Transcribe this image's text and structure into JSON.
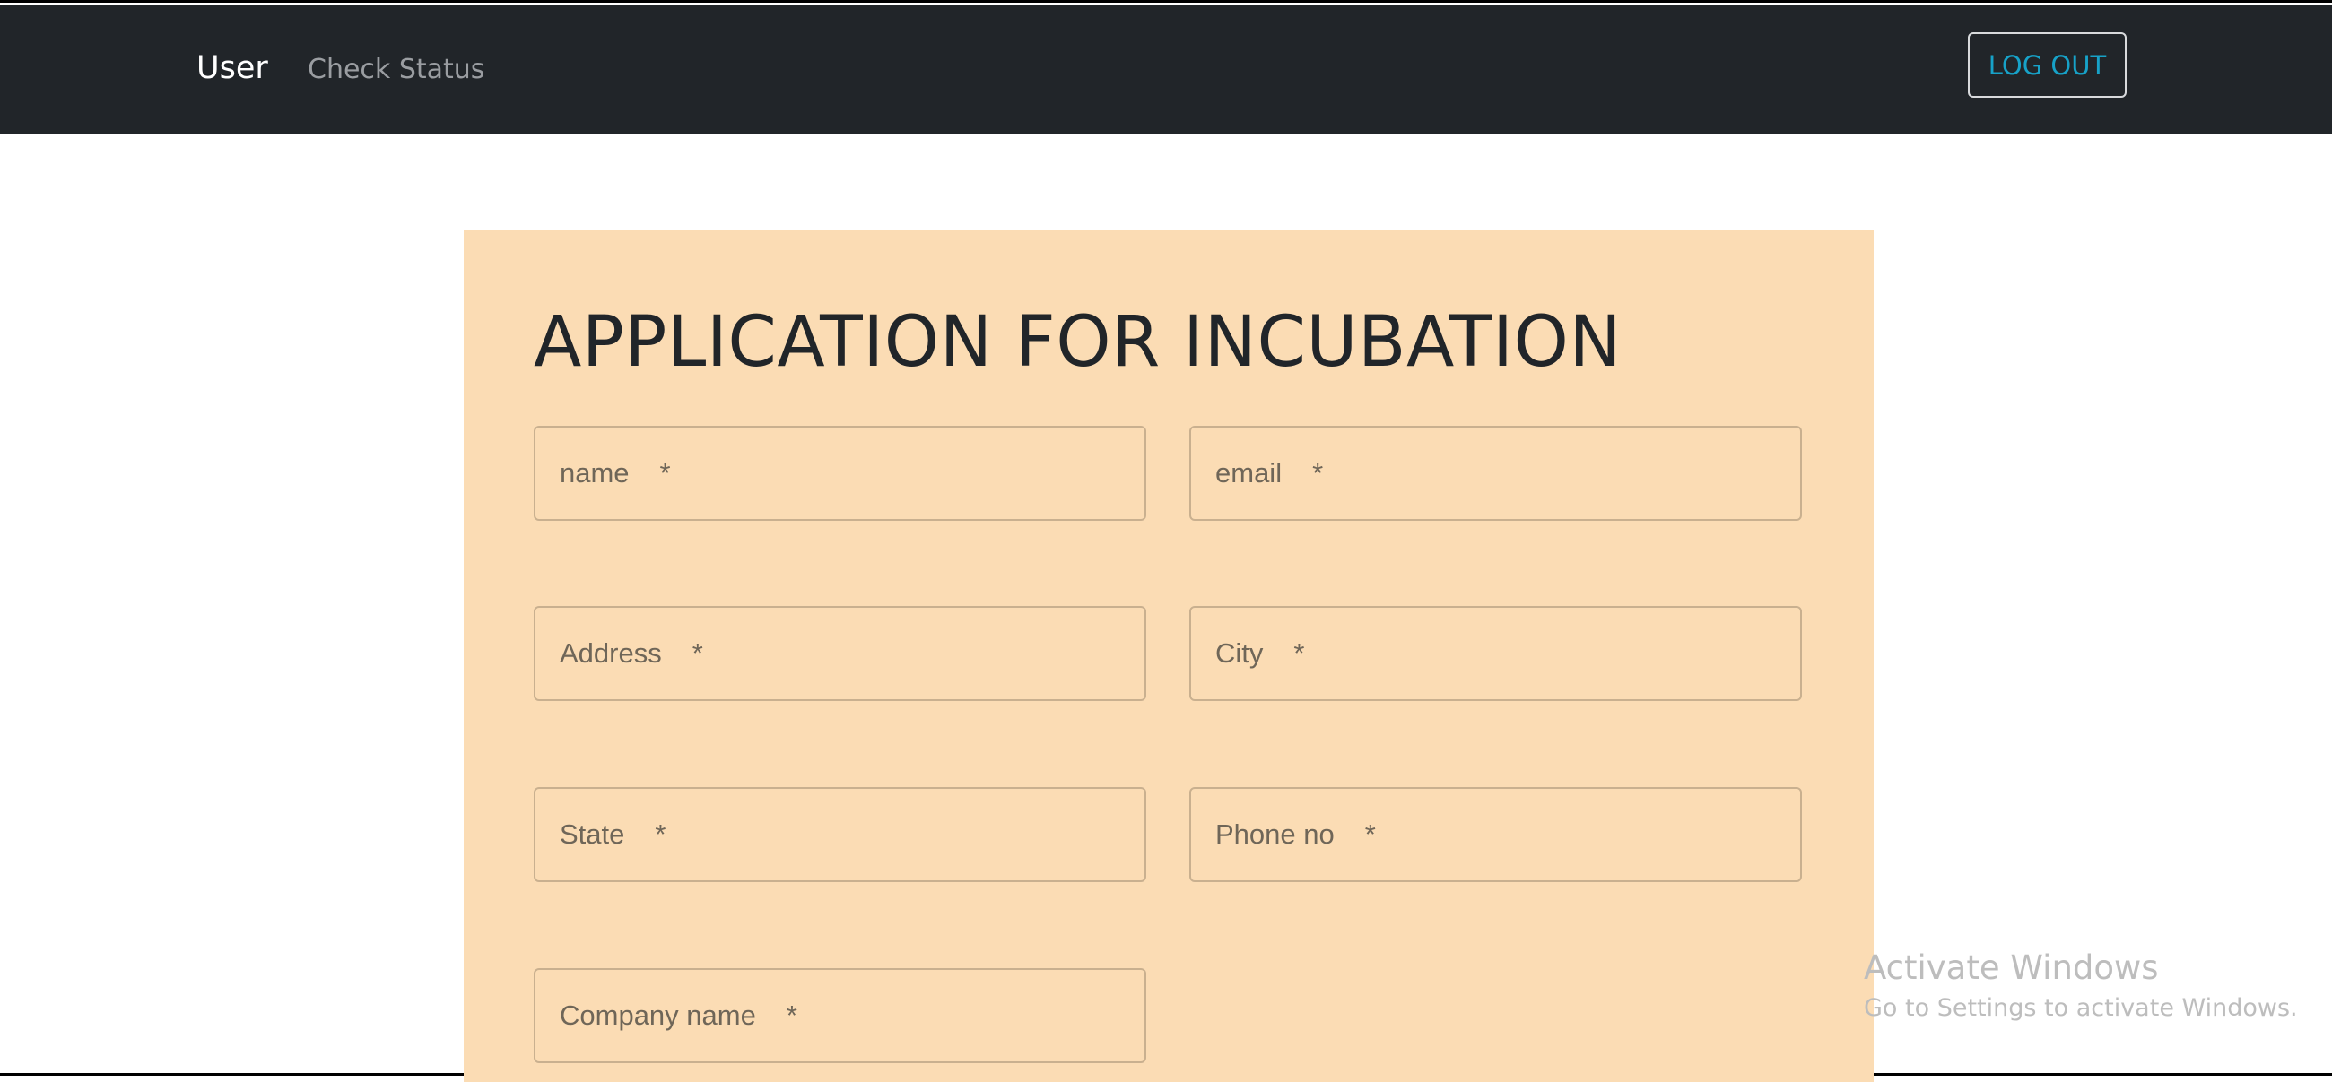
{
  "navbar": {
    "brand": "User",
    "links": [
      {
        "label": "Check Status"
      }
    ],
    "logout_label": "LOG OUT"
  },
  "form": {
    "title": "APPLICATION FOR INCUBATION",
    "required_marker": "*",
    "fields": [
      {
        "placeholder": "name",
        "value": ""
      },
      {
        "placeholder": "email",
        "value": ""
      },
      {
        "placeholder": "Address",
        "value": ""
      },
      {
        "placeholder": "City",
        "value": ""
      },
      {
        "placeholder": "State",
        "value": ""
      },
      {
        "placeholder": "Phone no",
        "value": ""
      },
      {
        "placeholder": "Company name",
        "value": ""
      }
    ]
  },
  "watermark": {
    "line1": "Activate Windows",
    "line2": "Go to Settings to activate Windows."
  },
  "colors": {
    "navbar": "#212529",
    "card": "#fbdcb4",
    "logout_text": "#17a2c8"
  }
}
